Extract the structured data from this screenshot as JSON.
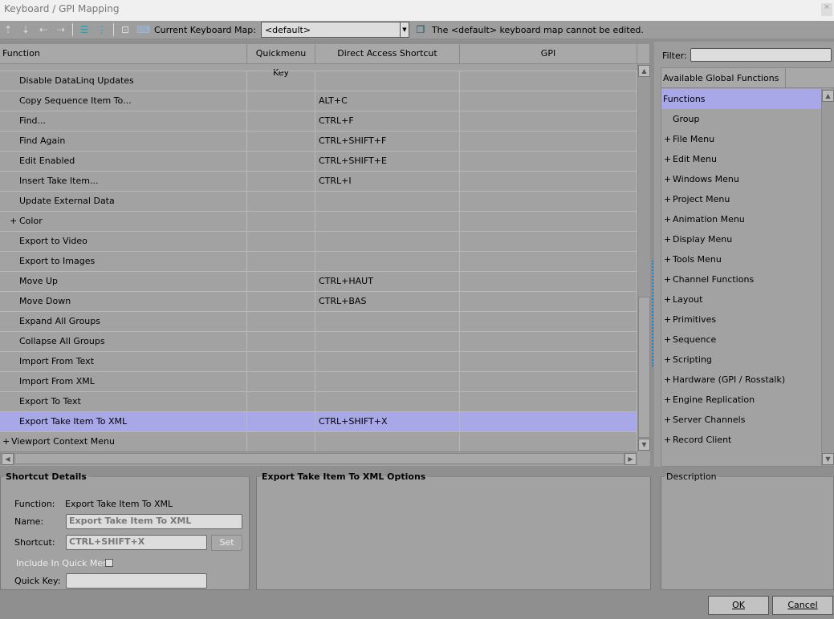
{
  "window": {
    "title": "Keyboard / GPI Mapping",
    "close": "×"
  },
  "toolbar": {
    "map_label": "Current Keyboard Map:",
    "map_value": "<default>",
    "message": "The <default> keyboard map cannot be edited."
  },
  "table": {
    "headers": [
      "Function",
      "Quickmenu Key",
      "Direct Access Shortcut",
      "GPI"
    ],
    "rows": [
      {
        "name": "Disable DataLinq Updates",
        "shortcut": "",
        "indent": 1
      },
      {
        "name": "Copy Sequence Item To...",
        "shortcut": "ALT+C",
        "indent": 1
      },
      {
        "name": "Find...",
        "shortcut": "CTRL+F",
        "indent": 1
      },
      {
        "name": "Find Again",
        "shortcut": "CTRL+SHIFT+F",
        "indent": 1
      },
      {
        "name": "Edit Enabled",
        "shortcut": "CTRL+SHIFT+E",
        "indent": 1
      },
      {
        "name": "Insert Take Item...",
        "shortcut": "CTRL+I",
        "indent": 1
      },
      {
        "name": "Update External Data",
        "shortcut": "",
        "indent": 1
      },
      {
        "name": "Color",
        "shortcut": "",
        "indent": 1,
        "expand": "+"
      },
      {
        "name": "Export to Video",
        "shortcut": "",
        "indent": 1
      },
      {
        "name": "Export to Images",
        "shortcut": "",
        "indent": 1
      },
      {
        "name": "Move Up",
        "shortcut": "CTRL+HAUT",
        "indent": 1
      },
      {
        "name": "Move Down",
        "shortcut": "CTRL+BAS",
        "indent": 1
      },
      {
        "name": "Expand All Groups",
        "shortcut": "",
        "indent": 1
      },
      {
        "name": "Collapse All Groups",
        "shortcut": "",
        "indent": 1
      },
      {
        "name": "Import From Text",
        "shortcut": "",
        "indent": 1
      },
      {
        "name": "Import From XML",
        "shortcut": "",
        "indent": 1
      },
      {
        "name": "Export To Text",
        "shortcut": "",
        "indent": 1
      },
      {
        "name": "Export Take Item To XML",
        "shortcut": "CTRL+SHIFT+X",
        "indent": 1,
        "selected": true
      },
      {
        "name": "Viewport Context Menu",
        "shortcut": "",
        "indent": 0,
        "expand": "+"
      }
    ]
  },
  "right": {
    "filter_label": "Filter:",
    "list_header": "Available Global Functions",
    "items": [
      {
        "label": "Functions",
        "selected": true,
        "prefix": ""
      },
      {
        "label": "Group",
        "prefix": ""
      },
      {
        "label": "File Menu",
        "prefix": "+"
      },
      {
        "label": "Edit Menu",
        "prefix": "+"
      },
      {
        "label": "Windows Menu",
        "prefix": "+"
      },
      {
        "label": "Project Menu",
        "prefix": "+"
      },
      {
        "label": "Animation Menu",
        "prefix": "+"
      },
      {
        "label": "Display Menu",
        "prefix": "+"
      },
      {
        "label": "Tools Menu",
        "prefix": "+"
      },
      {
        "label": "Channel Functions",
        "prefix": "+"
      },
      {
        "label": "Layout",
        "prefix": "+"
      },
      {
        "label": "Primitives",
        "prefix": "+"
      },
      {
        "label": "Sequence",
        "prefix": "+"
      },
      {
        "label": "Scripting",
        "prefix": "+"
      },
      {
        "label": "Hardware (GPI / Rosstalk)",
        "prefix": "+"
      },
      {
        "label": "Engine Replication",
        "prefix": "+"
      },
      {
        "label": "Server Channels",
        "prefix": "+"
      },
      {
        "label": "Record Client",
        "prefix": "+"
      }
    ]
  },
  "details": {
    "title": "Shortcut Details",
    "function_label": "Function:",
    "function_value": "Export Take Item To XML",
    "name_label": "Name:",
    "name_value": "Export Take Item To XML",
    "shortcut_label": "Shortcut:",
    "shortcut_value": "CTRL+SHIFT+X",
    "set_label": "Set",
    "include_label": "Include In Quick Menu",
    "quickkey_label": "Quick Key:",
    "quickkey_value": ""
  },
  "options": {
    "title": "Export Take Item To XML Options"
  },
  "description": {
    "title": "Description"
  },
  "buttons": {
    "ok": "OK",
    "cancel": "Cancel"
  }
}
